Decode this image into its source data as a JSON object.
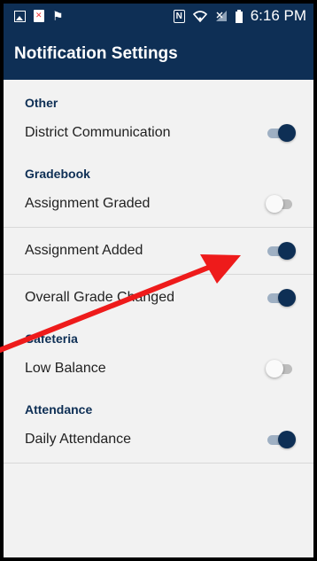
{
  "status_bar": {
    "time": "6:16 PM",
    "icons": [
      "gallery-icon",
      "doc-error-icon",
      "notification-flag-icon",
      "nfc-icon",
      "wifi-icon",
      "no-signal-icon",
      "battery-icon"
    ]
  },
  "app_bar": {
    "title": "Notification Settings"
  },
  "accent_color": "#0e2f55",
  "sections": [
    {
      "header": "Other",
      "items": [
        {
          "label": "District Communication",
          "enabled": true
        }
      ]
    },
    {
      "header": "Gradebook",
      "items": [
        {
          "label": "Assignment Graded",
          "enabled": false
        },
        {
          "label": "Assignment Added",
          "enabled": true
        },
        {
          "label": "Overall Grade Changed",
          "enabled": true
        }
      ]
    },
    {
      "header": "Cafeteria",
      "items": [
        {
          "label": "Low Balance",
          "enabled": false
        }
      ]
    },
    {
      "header": "Attendance",
      "items": [
        {
          "label": "Daily Attendance",
          "enabled": true
        }
      ]
    }
  ],
  "annotation": {
    "type": "red-arrow",
    "points_to": "Assignment Added toggle"
  }
}
